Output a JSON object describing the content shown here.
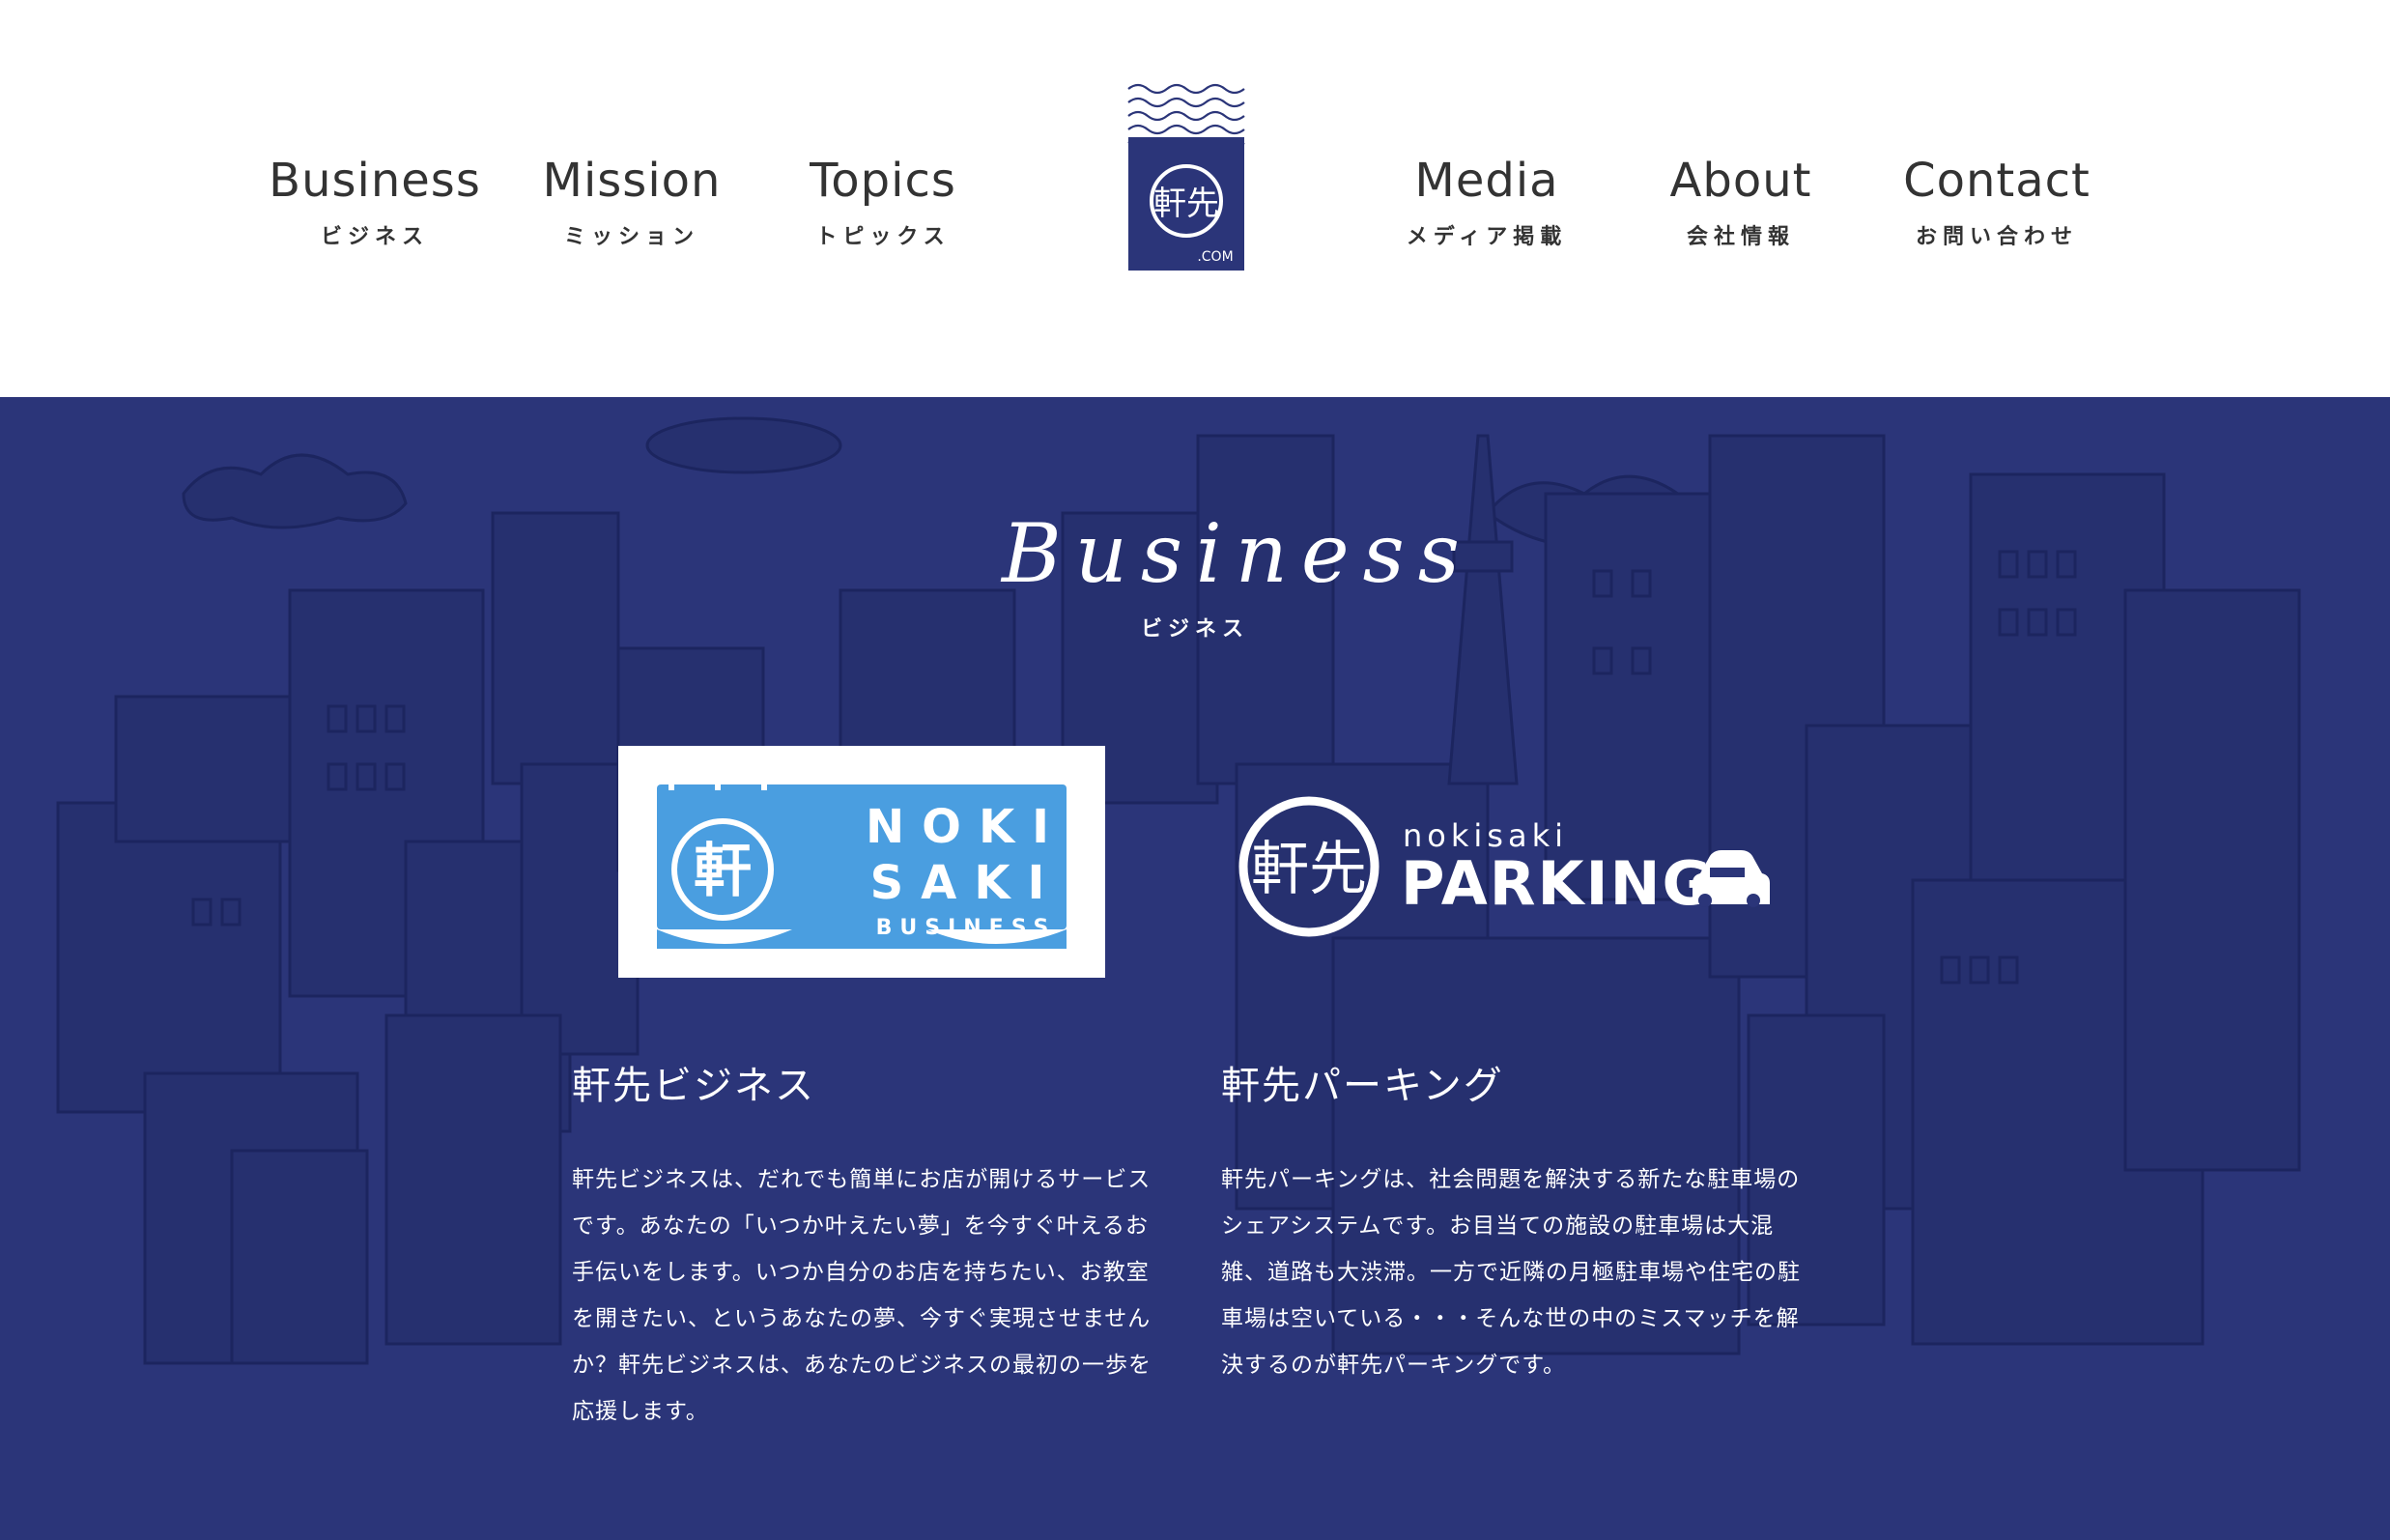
{
  "header": {
    "nav_left": [
      {
        "en": "Business",
        "ja": "ビジネス"
      },
      {
        "en": "Mission",
        "ja": "ミッション"
      },
      {
        "en": "Topics",
        "ja": "トピックス"
      }
    ],
    "nav_right": [
      {
        "en": "Media",
        "ja": "メディア掲載"
      },
      {
        "en": "About",
        "ja": "会社情報"
      },
      {
        "en": "Contact",
        "ja": "お問い合わせ"
      }
    ],
    "logo": {
      "kanji": "軒先",
      "domain": ".COM",
      "icon": "nokisaki-logo"
    }
  },
  "business": {
    "title": "Business",
    "subtitle": "ビジネス",
    "background_color": "#2b3579",
    "cards": [
      {
        "logo": {
          "icon": "nokisaki-business-logo",
          "kanji": "軒",
          "line1": "NOKI",
          "line2": "SAKI",
          "line3": "BUSINESS",
          "color": "#4a9ee0"
        },
        "title": "軒先ビジネス",
        "description": "軒先ビジネスは、だれでも簡単にお店が開けるサービスです。あなたの「いつか叶えたい夢」を今すぐ叶えるお手伝いをします。いつか自分のお店を持ちたい、お教室を開きたい、というあなたの夢、今すぐ実現させませんか？軒先ビジネスは、あなたのビジネスの最初の一歩を応援します。"
      },
      {
        "logo": {
          "icon": "nokisaki-parking-logo",
          "kanji": "軒先",
          "small": "nokisaki",
          "big": "PARKING",
          "car_icon": "car-icon"
        },
        "title": "軒先パーキング",
        "description": "軒先パーキングは、社会問題を解決する新たな駐車場のシェアシステムです。お目当ての施設の駐車場は大混雑、道路も大渋滞。一方で近隣の月極駐車場や住宅の駐車場は空いている・・・そんな世の中のミスマッチを解決するのが軒先パーキングです。"
      }
    ]
  }
}
